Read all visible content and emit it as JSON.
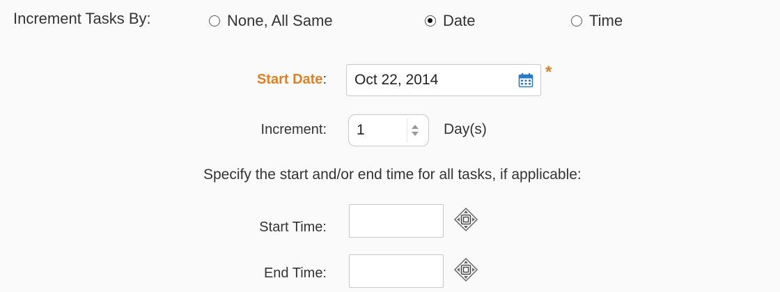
{
  "increment": {
    "label": "Increment Tasks By:",
    "options": [
      {
        "label": "None, All Same",
        "selected": false
      },
      {
        "label": "Date",
        "selected": true
      },
      {
        "label": "Time",
        "selected": false
      }
    ]
  },
  "start_date": {
    "label": "Start Date",
    "colon": ":",
    "value": "Oct 22, 2014",
    "required_marker": "*"
  },
  "increment_amount": {
    "label": "Increment:",
    "value": "1",
    "unit": "Day(s)"
  },
  "time_note": "Specify the start and/or end time for all tasks, if applicable:",
  "start_time": {
    "label": "Start Time:",
    "value": ""
  },
  "end_time": {
    "label": "End Time:",
    "value": ""
  },
  "colors": {
    "accent": "#e08020",
    "text": "#333333",
    "background": "#fafafa",
    "field_border": "#c8c8c8",
    "calendar_blue": "#2a78c8"
  },
  "icons": {
    "calendar": "calendar-icon",
    "time_picker": "time-picker-icon",
    "stepper": "stepper-arrows-icon"
  }
}
